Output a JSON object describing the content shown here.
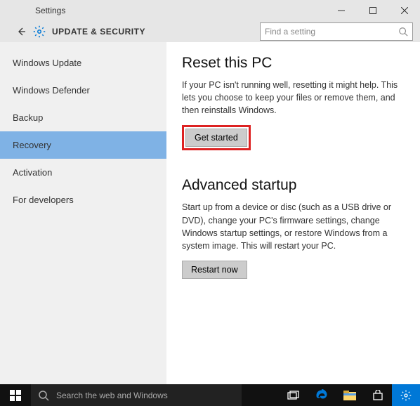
{
  "window": {
    "title": "Settings"
  },
  "header": {
    "title": "UPDATE & SECURITY"
  },
  "search": {
    "placeholder": "Find a setting"
  },
  "sidebar": {
    "items": [
      {
        "label": "Windows Update",
        "active": false
      },
      {
        "label": "Windows Defender",
        "active": false
      },
      {
        "label": "Backup",
        "active": false
      },
      {
        "label": "Recovery",
        "active": true
      },
      {
        "label": "Activation",
        "active": false
      },
      {
        "label": "For developers",
        "active": false
      }
    ]
  },
  "sections": {
    "reset": {
      "title": "Reset this PC",
      "body": "If your PC isn't running well, resetting it might help. This lets you choose to keep your files or remove them, and then reinstalls Windows.",
      "button": "Get started"
    },
    "advanced": {
      "title": "Advanced startup",
      "body": "Start up from a device or disc (such as a USB drive or DVD), change your PC's firmware settings, change Windows startup settings, or restore Windows from a system image. This will restart your PC.",
      "button": "Restart now"
    }
  },
  "taskbar": {
    "cortana": "Search the web and Windows"
  }
}
